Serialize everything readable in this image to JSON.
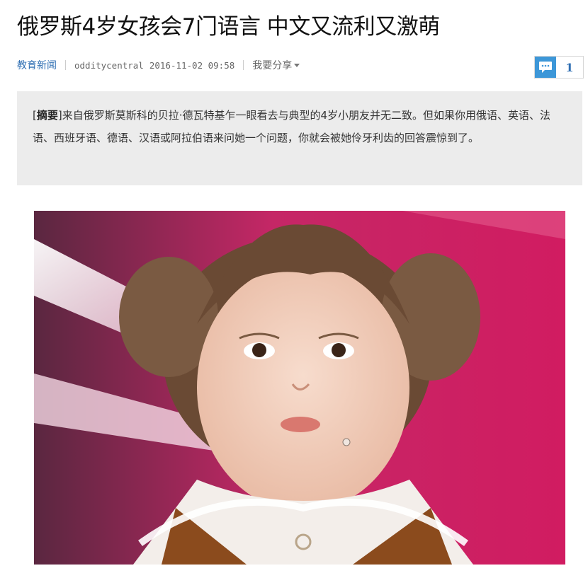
{
  "article": {
    "title": "俄罗斯4岁女孩会7门语言 中文又流利又激萌",
    "category": "教育新闻",
    "source": "odditycentral",
    "datetime": "2016-11-02 09:58",
    "share_label": "我要分享",
    "comment_count": "1"
  },
  "summary": {
    "bracket_open": "[",
    "label": "摘要",
    "bracket_close": "]",
    "text": "来自俄罗斯莫斯科的贝拉·德瓦特基乍一眼看去与典型的4岁小朋友并无二致。但如果你用俄语、英语、法语、西班牙语、德语、汉语或阿拉伯语来问她一个问题，你就会被她伶牙利齿的回答震惊到了。"
  },
  "icons": {
    "comment": "comment-bubble-icon",
    "share_caret": "caret-down-icon"
  },
  "colors": {
    "link": "#2f6fb3",
    "summary_bg": "#ececec",
    "comment_icon_bg": "#3d97d8"
  }
}
